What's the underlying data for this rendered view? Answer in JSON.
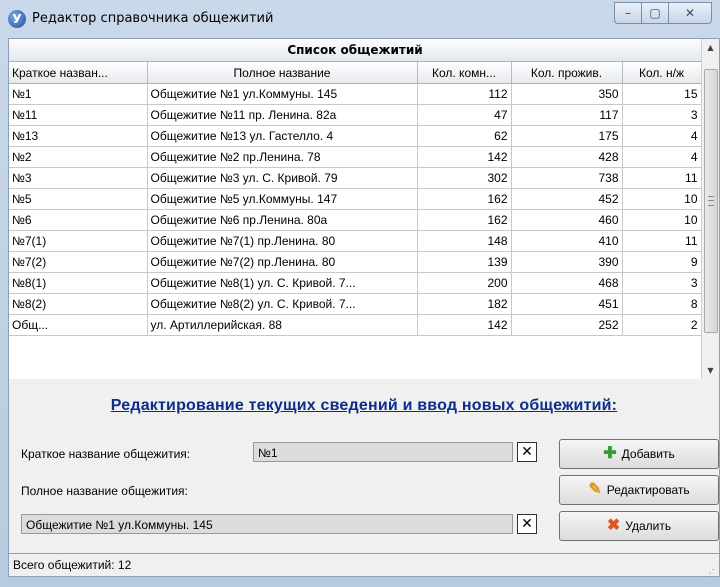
{
  "window": {
    "title": "Редактор справочника общежитий",
    "app_icon": "У"
  },
  "grid": {
    "title": "Список общежитий",
    "columns": [
      "Краткое назван...",
      "Полное название",
      "Кол. комн...",
      "Кол. прожив.",
      "Кол. н/ж"
    ],
    "rows": [
      [
        "№1",
        "Общежитие №1 ул.Коммуны. 145",
        "112",
        "350",
        "15"
      ],
      [
        "№11",
        "Общежитие №11 пр. Ленина. 82а",
        "47",
        "117",
        "3"
      ],
      [
        "№13",
        "Общежитие №13 ул. Гастелло. 4",
        "62",
        "175",
        "4"
      ],
      [
        "№2",
        "Общежитие №2 пр.Ленина. 78",
        "142",
        "428",
        "4"
      ],
      [
        "№3",
        "Общежитие №3 ул. С. Кривой. 79",
        "302",
        "738",
        "11"
      ],
      [
        "№5",
        "Общежитие №5 ул.Коммуны. 147",
        "162",
        "452",
        "10"
      ],
      [
        "№6",
        "Общежитие №6 пр.Ленина. 80а",
        "162",
        "460",
        "10"
      ],
      [
        "№7(1)",
        "Общежитие №7(1) пр.Ленина. 80",
        "148",
        "410",
        "11"
      ],
      [
        "№7(2)",
        "Общежитие №7(2) пр.Ленина. 80",
        "139",
        "390",
        "9"
      ],
      [
        "№8(1)",
        "Общежитие №8(1) ул. С. Кривой. 7...",
        "200",
        "468",
        "3"
      ],
      [
        "№8(2)",
        "Общежитие №8(2) ул. С. Кривой. 7...",
        "182",
        "451",
        "8"
      ],
      [
        "Общ...",
        "ул. Артиллерийская. 88",
        "142",
        "252",
        "2"
      ]
    ]
  },
  "edit": {
    "title": "Редактирование текущих сведений и ввод новых общежитий:",
    "short_label": "Краткое название общежития:",
    "short_value": "№1",
    "full_label": "Полное название общежития:",
    "full_value": "Общежитие №1 ул.Коммуны. 145",
    "clear_glyph": "✕",
    "add_label": "Добавить",
    "edit_label": "Редактировать",
    "delete_label": "Удалить"
  },
  "status": {
    "text": "Всего общежитий: 12"
  },
  "colors": {
    "title_blue": "#0b2e8a",
    "add_icon": "#2f9e2f",
    "edit_icon": "#d99a1f",
    "delete_icon": "#e0541b"
  }
}
